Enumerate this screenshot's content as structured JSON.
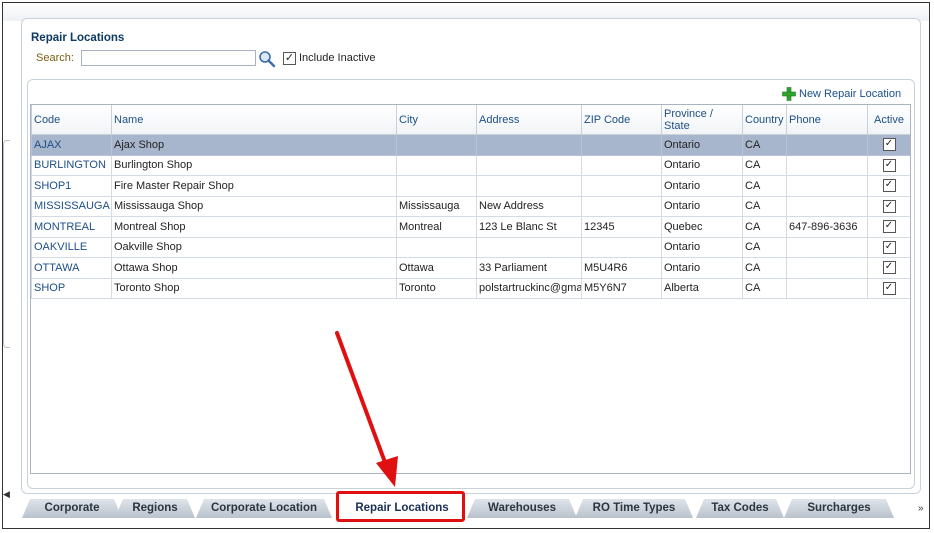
{
  "panel": {
    "title": "Repair Locations",
    "search_label": "Search:",
    "search_value": "",
    "include_inactive_label": "Include Inactive",
    "include_inactive_checked": true,
    "new_button_label": "New Repair Location"
  },
  "table": {
    "columns": [
      "Code",
      "Name",
      "City",
      "Address",
      "ZIP Code",
      "Province / State",
      "Country",
      "Phone",
      "Active"
    ],
    "rows": [
      {
        "code": "AJAX",
        "name": "Ajax Shop",
        "city": "",
        "address": "",
        "zip": "",
        "province": "Ontario",
        "country": "CA",
        "phone": "",
        "active": true,
        "selected": true
      },
      {
        "code": "BURLINGTON",
        "name": "Burlington Shop",
        "city": "",
        "address": "",
        "zip": "",
        "province": "Ontario",
        "country": "CA",
        "phone": "",
        "active": true
      },
      {
        "code": "SHOP1",
        "name": "Fire Master Repair Shop",
        "city": "",
        "address": "",
        "zip": "",
        "province": "Ontario",
        "country": "CA",
        "phone": "",
        "active": true
      },
      {
        "code": "MISSISSAUGA",
        "name": "Mississauga Shop",
        "city": "Mississauga",
        "address": "New Address",
        "zip": "",
        "province": "Ontario",
        "country": "CA",
        "phone": "",
        "active": true
      },
      {
        "code": "MONTREAL",
        "name": "Montreal Shop",
        "city": "Montreal",
        "address": "123 Le Blanc St",
        "zip": "12345",
        "province": "Quebec",
        "country": "CA",
        "phone": "647-896-3636",
        "active": true
      },
      {
        "code": "OAKVILLE",
        "name": "Oakville Shop",
        "city": "",
        "address": "",
        "zip": "",
        "province": "Ontario",
        "country": "CA",
        "phone": "",
        "active": true
      },
      {
        "code": "OTTAWA",
        "name": "Ottawa Shop",
        "city": "Ottawa",
        "address": "33 Parliament",
        "zip": "M5U4R6",
        "province": "Ontario",
        "country": "CA",
        "phone": "",
        "active": true
      },
      {
        "code": "SHOP",
        "name": "Toronto Shop",
        "city": "Toronto",
        "address": "polstartruckinc@gmai",
        "zip": "M5Y6N7",
        "province": "Alberta",
        "country": "CA",
        "phone": "",
        "active": true
      }
    ]
  },
  "tabs": [
    {
      "label": "Corporate"
    },
    {
      "label": "Regions"
    },
    {
      "label": "Corporate Location"
    },
    {
      "label": "Repair Locations",
      "active": true
    },
    {
      "label": "Warehouses"
    },
    {
      "label": "RO Time Types"
    },
    {
      "label": "Tax Codes"
    },
    {
      "label": "Surcharges"
    }
  ],
  "icons": {
    "search": "magnifier-icon",
    "new": "plus-icon",
    "tab_left": "scroll-left-icon",
    "tab_right": "scroll-right-icon"
  },
  "colors": {
    "accent": "#1c4f86",
    "selected_row": "#a8b6cd",
    "annotation": "#e01010",
    "new_icon": "#2fa52f"
  }
}
